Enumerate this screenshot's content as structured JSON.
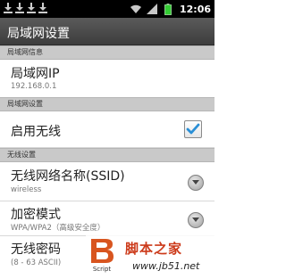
{
  "status_bar": {
    "notification_icons": [
      "download-icon",
      "download-icon",
      "download-icon",
      "download-icon"
    ],
    "time": "12:06"
  },
  "title": "局域网设置",
  "sections": {
    "info": "局域网信息",
    "lan": "局域网设置",
    "wireless": "无线设置"
  },
  "lan_ip": {
    "title": "局域网IP",
    "value": "192.168.0.1"
  },
  "enable_wireless": {
    "title": "启用无线",
    "checked": true
  },
  "ssid": {
    "title": "无线网络名称(SSID)",
    "value": "wireless"
  },
  "encryption": {
    "title": "加密模式",
    "value": "WPA/WPA2（高级安全度）"
  },
  "password": {
    "title": "无线密码",
    "hint": "(8 - 63 ASCII)"
  },
  "watermark": {
    "script": "Script",
    "name": "脚本之家",
    "url": "www.jb51.net"
  },
  "colors": {
    "check": "#2a8fd6",
    "watermark_red": "#cc3a1a"
  }
}
